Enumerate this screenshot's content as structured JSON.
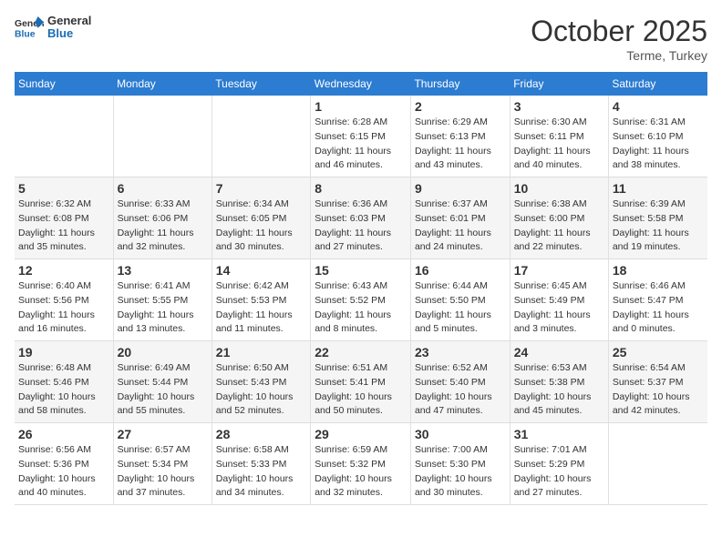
{
  "header": {
    "logo_general": "General",
    "logo_blue": "Blue",
    "month": "October 2025",
    "location": "Terme, Turkey"
  },
  "weekdays": [
    "Sunday",
    "Monday",
    "Tuesday",
    "Wednesday",
    "Thursday",
    "Friday",
    "Saturday"
  ],
  "weeks": [
    [
      {
        "num": "",
        "info": ""
      },
      {
        "num": "",
        "info": ""
      },
      {
        "num": "",
        "info": ""
      },
      {
        "num": "1",
        "info": "Sunrise: 6:28 AM\nSunset: 6:15 PM\nDaylight: 11 hours and 46 minutes."
      },
      {
        "num": "2",
        "info": "Sunrise: 6:29 AM\nSunset: 6:13 PM\nDaylight: 11 hours and 43 minutes."
      },
      {
        "num": "3",
        "info": "Sunrise: 6:30 AM\nSunset: 6:11 PM\nDaylight: 11 hours and 40 minutes."
      },
      {
        "num": "4",
        "info": "Sunrise: 6:31 AM\nSunset: 6:10 PM\nDaylight: 11 hours and 38 minutes."
      }
    ],
    [
      {
        "num": "5",
        "info": "Sunrise: 6:32 AM\nSunset: 6:08 PM\nDaylight: 11 hours and 35 minutes."
      },
      {
        "num": "6",
        "info": "Sunrise: 6:33 AM\nSunset: 6:06 PM\nDaylight: 11 hours and 32 minutes."
      },
      {
        "num": "7",
        "info": "Sunrise: 6:34 AM\nSunset: 6:05 PM\nDaylight: 11 hours and 30 minutes."
      },
      {
        "num": "8",
        "info": "Sunrise: 6:36 AM\nSunset: 6:03 PM\nDaylight: 11 hours and 27 minutes."
      },
      {
        "num": "9",
        "info": "Sunrise: 6:37 AM\nSunset: 6:01 PM\nDaylight: 11 hours and 24 minutes."
      },
      {
        "num": "10",
        "info": "Sunrise: 6:38 AM\nSunset: 6:00 PM\nDaylight: 11 hours and 22 minutes."
      },
      {
        "num": "11",
        "info": "Sunrise: 6:39 AM\nSunset: 5:58 PM\nDaylight: 11 hours and 19 minutes."
      }
    ],
    [
      {
        "num": "12",
        "info": "Sunrise: 6:40 AM\nSunset: 5:56 PM\nDaylight: 11 hours and 16 minutes."
      },
      {
        "num": "13",
        "info": "Sunrise: 6:41 AM\nSunset: 5:55 PM\nDaylight: 11 hours and 13 minutes."
      },
      {
        "num": "14",
        "info": "Sunrise: 6:42 AM\nSunset: 5:53 PM\nDaylight: 11 hours and 11 minutes."
      },
      {
        "num": "15",
        "info": "Sunrise: 6:43 AM\nSunset: 5:52 PM\nDaylight: 11 hours and 8 minutes."
      },
      {
        "num": "16",
        "info": "Sunrise: 6:44 AM\nSunset: 5:50 PM\nDaylight: 11 hours and 5 minutes."
      },
      {
        "num": "17",
        "info": "Sunrise: 6:45 AM\nSunset: 5:49 PM\nDaylight: 11 hours and 3 minutes."
      },
      {
        "num": "18",
        "info": "Sunrise: 6:46 AM\nSunset: 5:47 PM\nDaylight: 11 hours and 0 minutes."
      }
    ],
    [
      {
        "num": "19",
        "info": "Sunrise: 6:48 AM\nSunset: 5:46 PM\nDaylight: 10 hours and 58 minutes."
      },
      {
        "num": "20",
        "info": "Sunrise: 6:49 AM\nSunset: 5:44 PM\nDaylight: 10 hours and 55 minutes."
      },
      {
        "num": "21",
        "info": "Sunrise: 6:50 AM\nSunset: 5:43 PM\nDaylight: 10 hours and 52 minutes."
      },
      {
        "num": "22",
        "info": "Sunrise: 6:51 AM\nSunset: 5:41 PM\nDaylight: 10 hours and 50 minutes."
      },
      {
        "num": "23",
        "info": "Sunrise: 6:52 AM\nSunset: 5:40 PM\nDaylight: 10 hours and 47 minutes."
      },
      {
        "num": "24",
        "info": "Sunrise: 6:53 AM\nSunset: 5:38 PM\nDaylight: 10 hours and 45 minutes."
      },
      {
        "num": "25",
        "info": "Sunrise: 6:54 AM\nSunset: 5:37 PM\nDaylight: 10 hours and 42 minutes."
      }
    ],
    [
      {
        "num": "26",
        "info": "Sunrise: 6:56 AM\nSunset: 5:36 PM\nDaylight: 10 hours and 40 minutes."
      },
      {
        "num": "27",
        "info": "Sunrise: 6:57 AM\nSunset: 5:34 PM\nDaylight: 10 hours and 37 minutes."
      },
      {
        "num": "28",
        "info": "Sunrise: 6:58 AM\nSunset: 5:33 PM\nDaylight: 10 hours and 34 minutes."
      },
      {
        "num": "29",
        "info": "Sunrise: 6:59 AM\nSunset: 5:32 PM\nDaylight: 10 hours and 32 minutes."
      },
      {
        "num": "30",
        "info": "Sunrise: 7:00 AM\nSunset: 5:30 PM\nDaylight: 10 hours and 30 minutes."
      },
      {
        "num": "31",
        "info": "Sunrise: 7:01 AM\nSunset: 5:29 PM\nDaylight: 10 hours and 27 minutes."
      },
      {
        "num": "",
        "info": ""
      }
    ]
  ]
}
